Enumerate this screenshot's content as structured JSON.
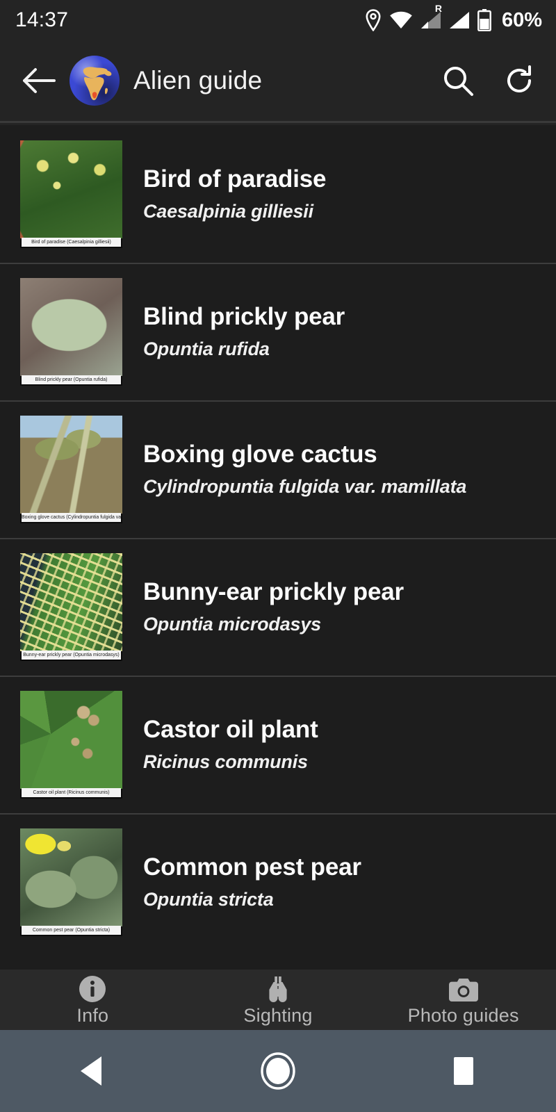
{
  "status_bar": {
    "time": "14:37",
    "battery_percent": "60%",
    "icons": [
      "location-pin-icon",
      "wifi-icon",
      "signal-roaming-icon",
      "signal-icon",
      "battery-icon"
    ],
    "roaming_label": "R"
  },
  "app_bar": {
    "back_icon": "arrow-back-icon",
    "logo_icon": "globe-africa-icon",
    "title": "Alien guide",
    "search_icon": "search-icon",
    "refresh_icon": "refresh-icon"
  },
  "list": {
    "items": [
      {
        "common_name": "Bird of paradise",
        "scientific_name": "Caesalpinia gilliesii",
        "thumbnail_caption": "Bird of paradise (Caesalpinia gilliesii)"
      },
      {
        "common_name": "Blind prickly pear",
        "scientific_name": "Opuntia rufida",
        "thumbnail_caption": "Blind prickly pear (Opuntia rufida)"
      },
      {
        "common_name": "Boxing glove cactus",
        "scientific_name": "Cylindropuntia fulgida var. mamillata",
        "thumbnail_caption": "Boxing glove cactus (Cylindropuntia fulgida var. mamillata)"
      },
      {
        "common_name": "Bunny-ear prickly pear",
        "scientific_name": "Opuntia microdasys",
        "thumbnail_caption": "Bunny-ear prickly pear (Opuntia microdasys)"
      },
      {
        "common_name": "Castor oil plant",
        "scientific_name": "Ricinus communis",
        "thumbnail_caption": "Castor oil plant (Ricinus communis)"
      },
      {
        "common_name": "Common pest pear",
        "scientific_name": "Opuntia stricta",
        "thumbnail_caption": "Common pest pear (Opuntia stricta)"
      }
    ]
  },
  "bottom_tabs": [
    {
      "label": "Info",
      "icon": "info-circle-icon"
    },
    {
      "label": "Sighting",
      "icon": "binoculars-icon"
    },
    {
      "label": "Photo guides",
      "icon": "camera-icon"
    }
  ],
  "system_nav": [
    {
      "name": "back",
      "icon": "triangle-back-icon"
    },
    {
      "name": "home",
      "icon": "circle-home-icon"
    },
    {
      "name": "recents",
      "icon": "square-recents-icon"
    }
  ],
  "colors": {
    "screen_bg": "#1d1d1d",
    "bar_bg": "#242424",
    "tabbar_bg": "#2a2a2a",
    "navbar_bg": "#4e5964",
    "divider": "#3d3d3d",
    "primary_text": "#fcfcfc",
    "secondary_text": "#b9b9b9"
  }
}
